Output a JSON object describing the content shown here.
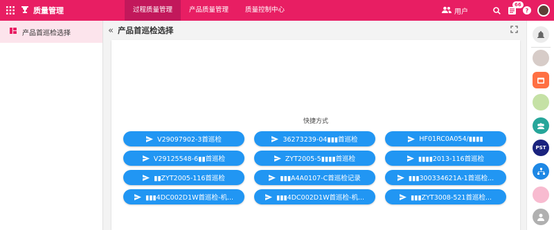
{
  "app": {
    "title": "质量管理"
  },
  "nav": [
    {
      "label": "过程质量管理",
      "active": true
    },
    {
      "label": "产品质量管理",
      "active": false
    },
    {
      "label": "质量控制中心",
      "active": false
    }
  ],
  "header": {
    "user_label": "用户",
    "notification_count": "66"
  },
  "sidebar": {
    "items": [
      {
        "label": "产品首巡检选择"
      }
    ]
  },
  "page": {
    "title": "产品首巡检选择"
  },
  "quick": {
    "label": "快捷方式",
    "buttons": [
      "V29097902-3首巡检",
      "36273239-04▮▮▮首巡检",
      "HF01RC0A054/▮▮▮▮",
      "V29125548-6▮▮首巡检",
      "ZYT2005-5▮▮▮▮首巡检",
      "▮▮▮▮2013-116首巡检",
      "▮▮ZYT2005-116首巡检",
      "▮▮▮A4A0107-C首巡检记录",
      "▮▮▮300334621A-1首巡检...",
      "▮▮▮4DC002D1W首巡检-机...",
      "▮▮▮4DC002D1W首巡检-机...",
      "▮▮▮ZYT3008-521首巡检..."
    ]
  },
  "colors": {
    "primary": "#e81e63",
    "active_nav": "#c2185b",
    "button": "#2196f3"
  }
}
